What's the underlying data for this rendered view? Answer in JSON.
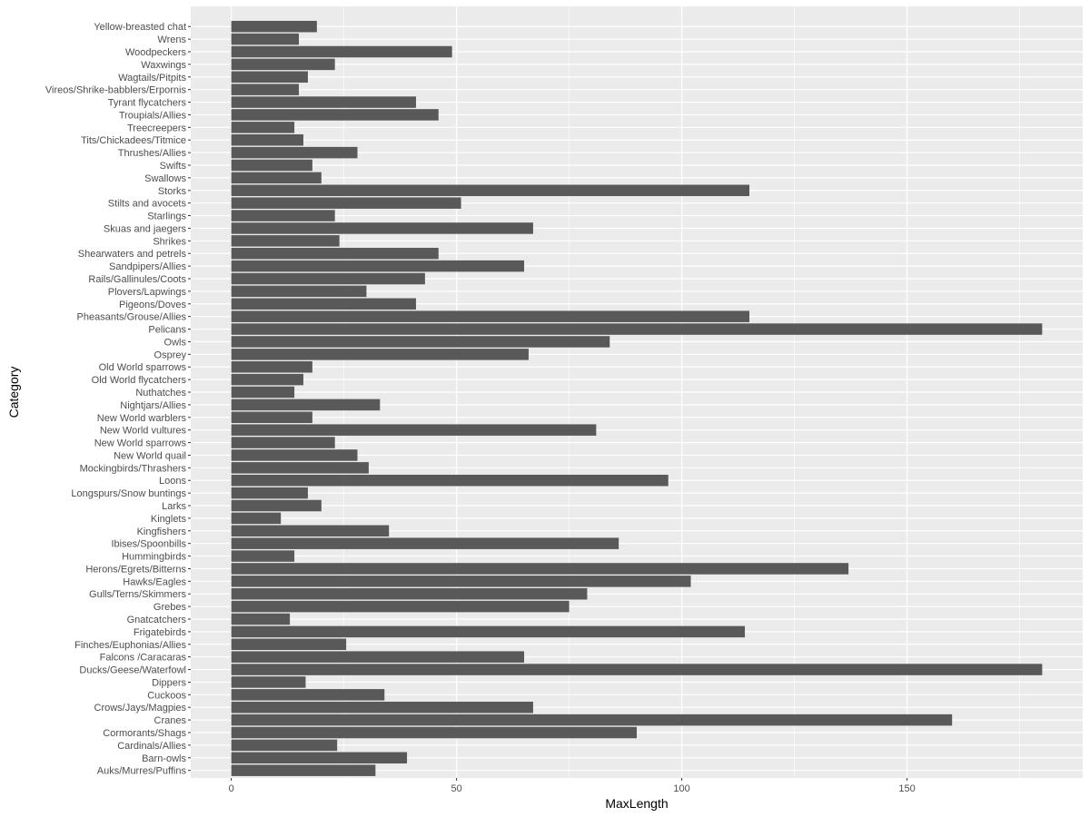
{
  "chart_data": {
    "type": "bar",
    "orientation": "horizontal",
    "title": "",
    "xlabel": "MaxLength",
    "ylabel": "Category",
    "xlim": [
      -9,
      189
    ],
    "xticks": [
      0,
      50,
      100,
      150
    ],
    "xtick_labels": [
      "0",
      "50",
      "100",
      "150"
    ],
    "grid": true,
    "legend": "none",
    "colors": {
      "bar": "#595959",
      "panel": "#ebebeb",
      "grid": "#ffffff",
      "tick_text": "#4d4d4d",
      "title_text": "#000000"
    },
    "categories": [
      "Auks/Murres/Puffins",
      "Barn-owls",
      "Cardinals/Allies",
      "Cormorants/Shags",
      "Cranes",
      "Crows/Jays/Magpies",
      "Cuckoos",
      "Dippers",
      "Ducks/Geese/Waterfowl",
      "Falcons /Caracaras",
      "Finches/Euphonias/Allies",
      "Frigatebirds",
      "Gnatcatchers",
      "Grebes",
      "Gulls/Terns/Skimmers",
      "Hawks/Eagles",
      "Herons/Egrets/Bitterns",
      "Hummingbirds",
      "Ibises/Spoonbills",
      "Kingfishers",
      "Kinglets",
      "Larks",
      "Longspurs/Snow buntings",
      "Loons",
      "Mockingbirds/Thrashers",
      "New World quail",
      "New World sparrows",
      "New World vultures",
      "New World warblers",
      "Nightjars/Allies",
      "Nuthatches",
      "Old World flycatchers",
      "Old World sparrows",
      "Osprey",
      "Owls",
      "Pelicans",
      "Pheasants/Grouse/Allies",
      "Pigeons/Doves",
      "Plovers/Lapwings",
      "Rails/Gallinules/Coots",
      "Sandpipers/Allies",
      "Shearwaters and petrels",
      "Shrikes",
      "Skuas and jaegers",
      "Starlings",
      "Stilts and avocets",
      "Storks",
      "Swallows",
      "Swifts",
      "Thrushes/Allies",
      "Tits/Chickadees/Titmice",
      "Treecreepers",
      "Troupials/Allies",
      "Tyrant flycatchers",
      "Vireos/Shrike-babblers/Erpornis",
      "Wagtails/Pitpits",
      "Waxwings",
      "Woodpeckers",
      "Wrens",
      "Yellow-breasted chat"
    ],
    "values": [
      32,
      39,
      23.5,
      90,
      160,
      67,
      34,
      16.5,
      180,
      65,
      25.5,
      114,
      13,
      75,
      79,
      102,
      137,
      14,
      86,
      35,
      11,
      20,
      17,
      97,
      30.5,
      28,
      23,
      81,
      18,
      33,
      14,
      16,
      18,
      66,
      84,
      180,
      115,
      41,
      30,
      43,
      65,
      46,
      24,
      67,
      23,
      51,
      115,
      20,
      18,
      28,
      16,
      14,
      46,
      41,
      15,
      17,
      23,
      49,
      15,
      19
    ]
  }
}
